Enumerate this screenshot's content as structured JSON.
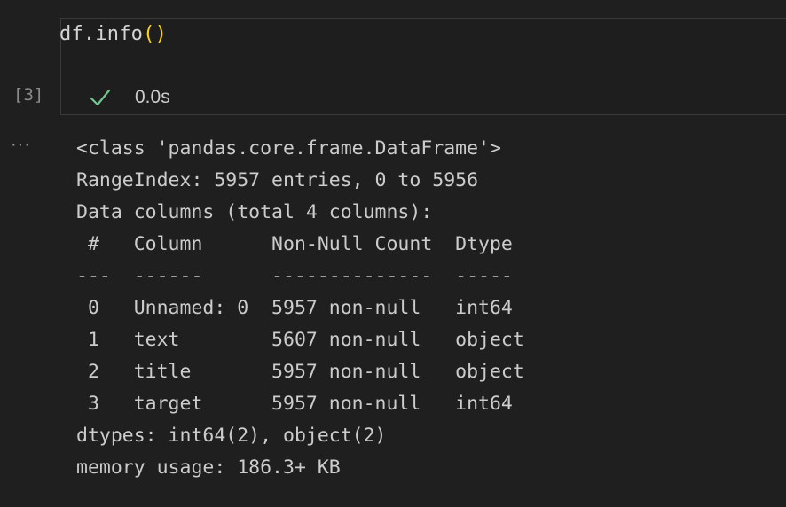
{
  "cell": {
    "code_prefix": "df.info",
    "code_parens": "()",
    "execution_count": "[3]",
    "status_icon": "check-icon",
    "status_color": "#73c991",
    "duration": "0.0s",
    "output_gutter": "···"
  },
  "output": {
    "lines": [
      "<class 'pandas.core.frame.DataFrame'>",
      "RangeIndex: 5957 entries, 0 to 5956",
      "Data columns (total 4 columns):",
      " #   Column      Non-Null Count  Dtype ",
      "---  ------      --------------  ----- ",
      " 0   Unnamed: 0  5957 non-null   int64 ",
      " 1   text        5607 non-null   object",
      " 2   title       5957 non-null   object",
      " 3   target      5957 non-null   int64 ",
      "dtypes: int64(2), object(2)",
      "memory usage: 186.3+ KB"
    ]
  }
}
